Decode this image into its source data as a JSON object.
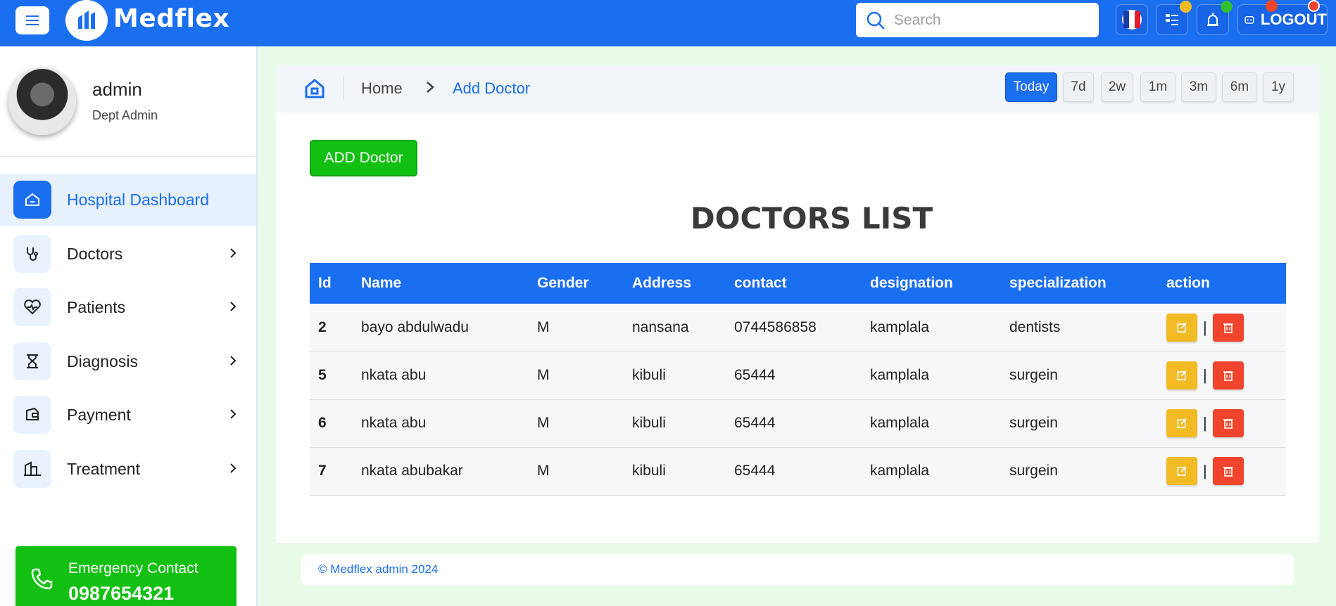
{
  "topbar": {
    "brand": "Medflex",
    "search_placeholder": "Search",
    "logout_label": "LOGOUT",
    "badge_colors": [
      "#f2bb24",
      "#2fbf2f",
      "#f0452c",
      "#f0452c"
    ]
  },
  "sidebar": {
    "user_name": "admin",
    "user_role": "Dept Admin",
    "items": [
      {
        "label": "Hospital Dashboard",
        "icon": "home-icon",
        "active": true
      },
      {
        "label": "Doctors",
        "icon": "stethoscope-icon"
      },
      {
        "label": "Patients",
        "icon": "heart-pulse-icon"
      },
      {
        "label": "Diagnosis",
        "icon": "hourglass-icon"
      },
      {
        "label": "Payment",
        "icon": "wallet-icon"
      },
      {
        "label": "Treatment",
        "icon": "building-icon"
      }
    ],
    "emergency": {
      "label": "Emergency Contact",
      "number": "0987654321"
    }
  },
  "breadcrumb": {
    "home": "Home",
    "current": "Add Doctor"
  },
  "ranges": [
    "Today",
    "7d",
    "2w",
    "1m",
    "3m",
    "6m",
    "1y"
  ],
  "main": {
    "add_button": "ADD Doctor",
    "title": "DOCTORS LIST",
    "columns": [
      "Id",
      "Name",
      "Gender",
      "Address",
      "contact",
      "designation",
      "specialization",
      "action"
    ],
    "rows": [
      {
        "id": "2",
        "name": "bayo abdulwadu",
        "gender": "M",
        "address": "nansana",
        "contact": "0744586858",
        "designation": "kamplala",
        "specialization": "dentists"
      },
      {
        "id": "5",
        "name": "nkata abu",
        "gender": "M",
        "address": "kibuli",
        "contact": "65444",
        "designation": "kamplala",
        "specialization": "surgein"
      },
      {
        "id": "6",
        "name": "nkata abu",
        "gender": "M",
        "address": "kibuli",
        "contact": "65444",
        "designation": "kamplala",
        "specialization": "surgein"
      },
      {
        "id": "7",
        "name": "nkata abubakar",
        "gender": "M",
        "address": "kibuli",
        "contact": "65444",
        "designation": "kamplala",
        "specialization": "surgein"
      }
    ],
    "action_separator": "|"
  },
  "footer": "© Medflex admin 2024"
}
